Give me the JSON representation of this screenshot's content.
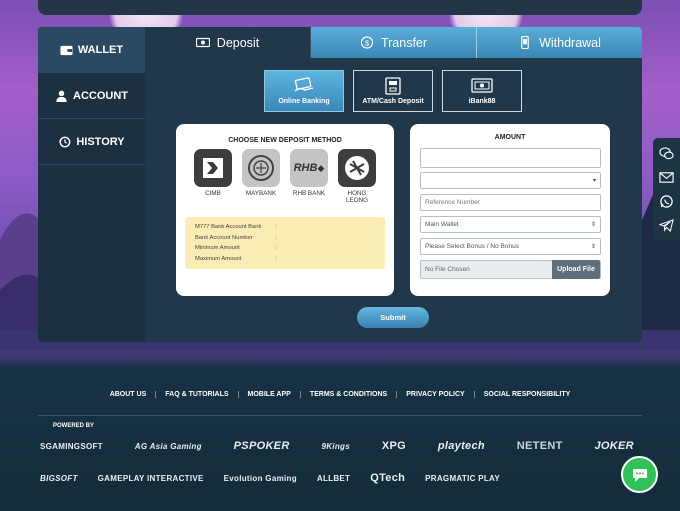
{
  "sidebar": {
    "items": [
      {
        "label": "WALLET",
        "icon": "wallet-icon"
      },
      {
        "label": "ACCOUNT",
        "icon": "user-icon"
      },
      {
        "label": "HISTORY",
        "icon": "history-icon"
      }
    ]
  },
  "tabs": [
    {
      "label": "Deposit",
      "icon": "cash-icon"
    },
    {
      "label": "Transfer",
      "icon": "transfer-icon"
    },
    {
      "label": "Withdrawal",
      "icon": "phone-icon"
    }
  ],
  "methods": [
    {
      "label": "Online Banking",
      "icon": "online-banking-icon"
    },
    {
      "label": "ATM/Cash Deposit",
      "icon": "atm-icon"
    },
    {
      "label": "iBank88",
      "icon": "ibank-icon"
    }
  ],
  "deposit": {
    "title": "CHOOSE NEW DEPOSIT METHOD",
    "banks": [
      {
        "name": "CIMB",
        "logo_text": ""
      },
      {
        "name": "MAYBANK",
        "logo_text": ""
      },
      {
        "name": "RHB BANK",
        "logo_text": "RHB"
      },
      {
        "name": "HONG LEONG",
        "logo_text": ""
      }
    ],
    "info": [
      {
        "label": "M777 Bank Account Bank",
        "sep": ":"
      },
      {
        "label": "Bank Account Number",
        "sep": ":"
      },
      {
        "label": "Minimum Amount",
        "sep": ":"
      },
      {
        "label": "Maximum Amount",
        "sep": ":"
      }
    ]
  },
  "amount": {
    "title": "AMOUNT",
    "reference_placeholder": "Reference Number",
    "wallet_value": "Main Wallet",
    "bonus_value": "Please Select Bonus / No Bonus",
    "file_value": "No File Chosen",
    "upload_label": "Upload File"
  },
  "submit_label": "Submit",
  "footer": {
    "links": [
      "ABOUT US",
      "FAQ & TUTORIALS",
      "MOBILE APP",
      "TERMS & CONDITIONS",
      "PRIVACY POLICY",
      "SOCIAL RESPONSIBILITY"
    ],
    "powered_by": "POWERED BY",
    "providers_row1": [
      "SGAMINGSOFT",
      "AG Asia Gaming",
      "PSPOKER",
      "9Kings",
      "XPG",
      "playtech",
      "NETENT",
      "JOKER"
    ],
    "providers_row2": [
      "BIGSOFT",
      "GAMEPLAY INTERACTIVE",
      "Evolution Gaming",
      "ALLBET",
      "QTech",
      "PRAGMATIC PLAY"
    ]
  },
  "colors": {
    "accent": "#3b86b5",
    "panel": "#1d3445",
    "footer": "#142c3b",
    "chat": "#2fc257"
  }
}
